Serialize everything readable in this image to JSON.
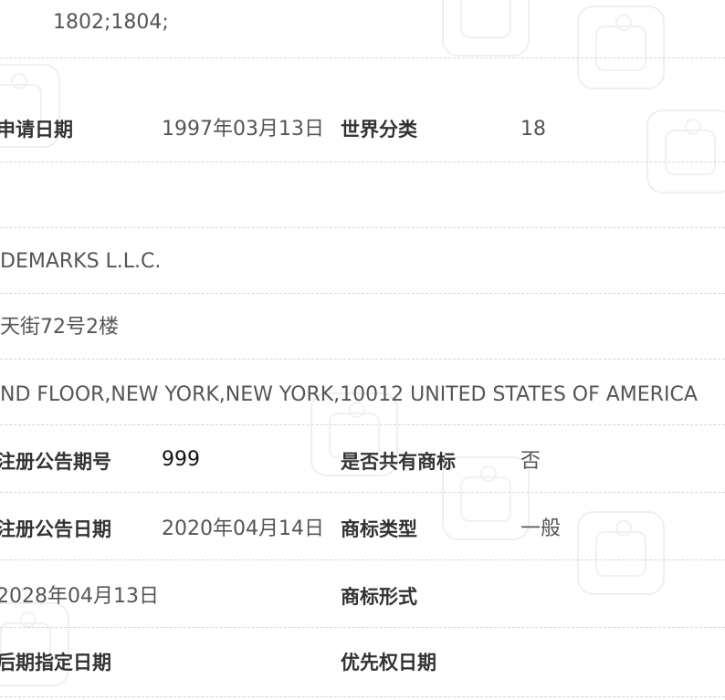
{
  "classes_line": "1802;1804;",
  "application": {
    "date_label": "申请日期",
    "date_value": "1997年03月13日",
    "class_label": "世界分类",
    "class_value": "18"
  },
  "applicant_name": "DEMARKS L.L.C.",
  "address_cn": "天街72号2楼",
  "address_en": "ND FLOOR,NEW YORK,NEW YORK,10012 UNITED STATES OF AMERICA",
  "registration": {
    "issue_no_label": "注册公告期号",
    "issue_no_value": "999",
    "shared_label": "是否共有商标",
    "shared_value": "否",
    "date_label": "注册公告日期",
    "date_value": "2020年04月14日",
    "type_label": "商标类型",
    "type_value": "一般"
  },
  "validity_end": "2028年04月13日",
  "form_label": "商标形式",
  "later_date_label": "后期指定日期",
  "priority_label": "优先权日期"
}
